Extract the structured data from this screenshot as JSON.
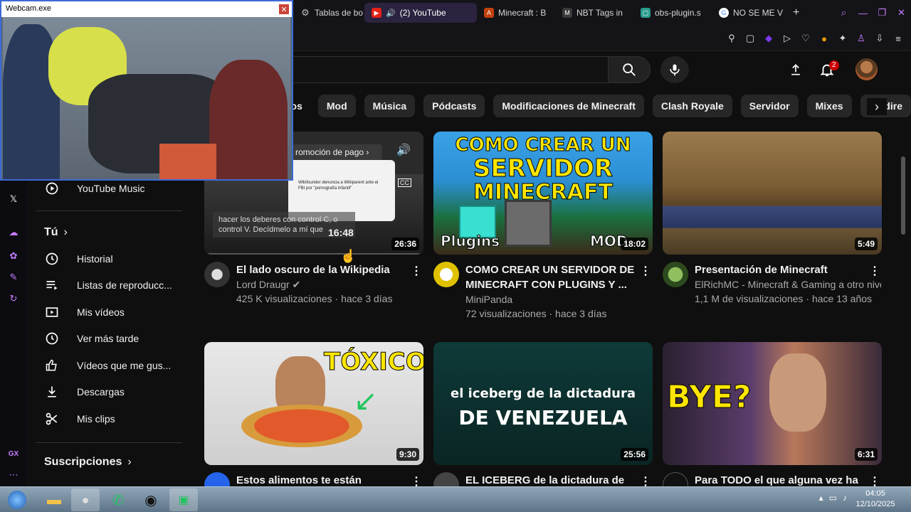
{
  "browser": {
    "tabs": [
      {
        "label": "Tablas de bo",
        "icon": "gear-icon"
      },
      {
        "label": "(2) YouTube",
        "icon": "youtube-icon",
        "active": true
      },
      {
        "label": "Minecraft : B",
        "icon": "minecraft-icon"
      },
      {
        "label": "NBT Tags in",
        "icon": "wiki-icon"
      },
      {
        "label": "obs-plugin.s",
        "icon": "obs-icon"
      },
      {
        "label": "NO SE ME V",
        "icon": "google-icon"
      }
    ],
    "new_tab": "+"
  },
  "youtube": {
    "notifications_count": "2",
    "chips": [
      "gos",
      "Mod",
      "Música",
      "Pódcasts",
      "Modificaciones de Minecraft",
      "Clash Royale",
      "Servidor",
      "Mixes",
      "En dire"
    ],
    "nav": {
      "youtube_music": "YouTube Music",
      "you_label": "Tú",
      "items": [
        "Historial",
        "Listas de reproducc...",
        "Mis vídeos",
        "Ver más tarde",
        "Vídeos que me gus...",
        "Descargas",
        "Mis clips"
      ],
      "subs_label": "Suscripciones"
    },
    "videos": [
      {
        "title": "El lado oscuro de la Wikipedia",
        "channel": "Lord Draugr",
        "stats": "425 K visualizaciones · hace 3 días",
        "duration": "26:36",
        "hover_time": "16:48",
        "promo": "romoción de pago",
        "overlay1": "hacer los deberes con control C, o",
        "overlay2": "control V. Decídmelo a mí que",
        "preview_text": "Wikifounder denuncia a Wikiparent ante el FBI por \"pornografía infantil\""
      },
      {
        "title": "COMO CREAR UN SERVIDOR DE MINECRAFT CON PLUGINS Y ...",
        "channel": "MiniPanda",
        "stats": "72 visualizaciones · hace 3 días",
        "duration": "18:02",
        "thumb1": "COMO CREAR UN",
        "thumb2": "SERVIDOR",
        "thumb3": "MINECRAFT",
        "thumb4": "Plugins",
        "thumb5": "MOD"
      },
      {
        "title": "Presentación de Minecraft",
        "channel": "ElRichMC - Minecraft & Gaming a otro nivel",
        "stats": "1,1 M de visualizaciones · hace 13 años",
        "duration": "5:49"
      },
      {
        "title": "Estos alimentos te están",
        "duration": "9:30",
        "thumb1": "TÓXICO"
      },
      {
        "title": "EL ICEBERG de la dictadura de",
        "duration": "25:56",
        "thumb1": "el iceberg de la dictadura",
        "thumb2": "DE VENEZUELA"
      },
      {
        "title": "Para TODO el que alguna vez ha",
        "duration": "6:31",
        "thumb1": "BYE?"
      }
    ]
  },
  "webcam": {
    "title": "Webcam.exe",
    "close": "✕"
  },
  "taskbar": {
    "time": "04:05",
    "date": "12/10/2025"
  }
}
